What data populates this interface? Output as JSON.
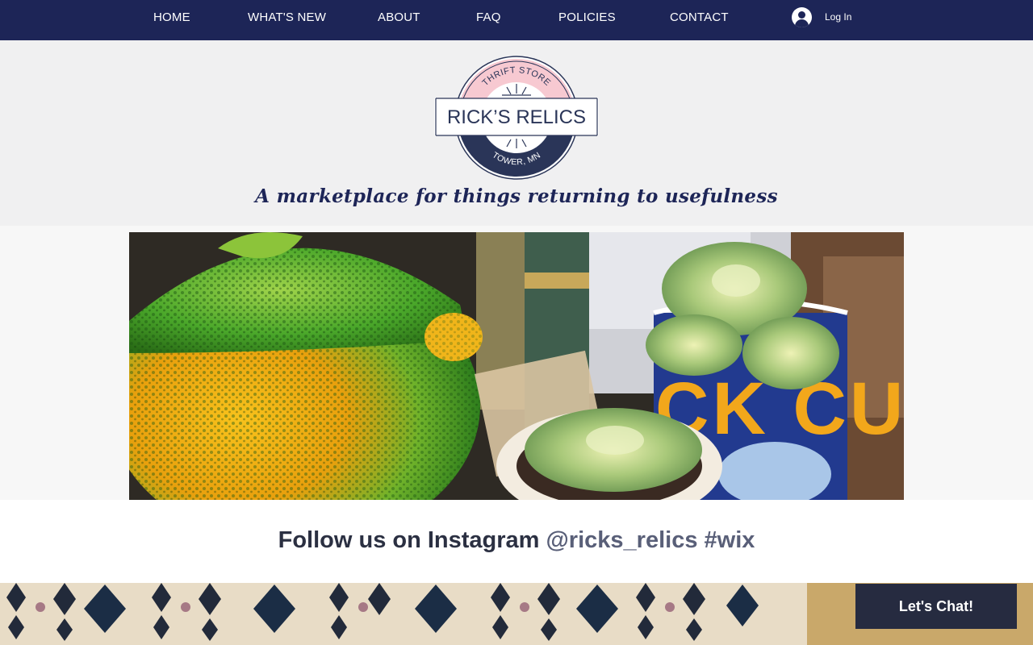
{
  "nav": {
    "items": [
      {
        "label": "HOME"
      },
      {
        "label": "WHAT'S NEW"
      },
      {
        "label": "ABOUT"
      },
      {
        "label": "FAQ"
      },
      {
        "label": "POLICIES"
      },
      {
        "label": "CONTACT"
      }
    ],
    "login_label": "Log In"
  },
  "logo": {
    "top_arc": "THRIFT STORE",
    "name": "RICK’S RELICS",
    "bottom_arc": "TOWER, MN"
  },
  "tagline": "A marketplace for things returning to usefulness",
  "hero": {
    "mug_text": "CK CU"
  },
  "instagram": {
    "prefix": "Follow us on Instagram",
    "handle": "@ricks_relics #wix"
  },
  "chat": {
    "label": "Let's Chat!"
  },
  "colors": {
    "nav_bg": "#1d2557",
    "header_bg": "#f0f0f1",
    "logo_pink": "#f7c9d1",
    "logo_navy": "#2a3558",
    "chat_bg": "#262b40"
  }
}
